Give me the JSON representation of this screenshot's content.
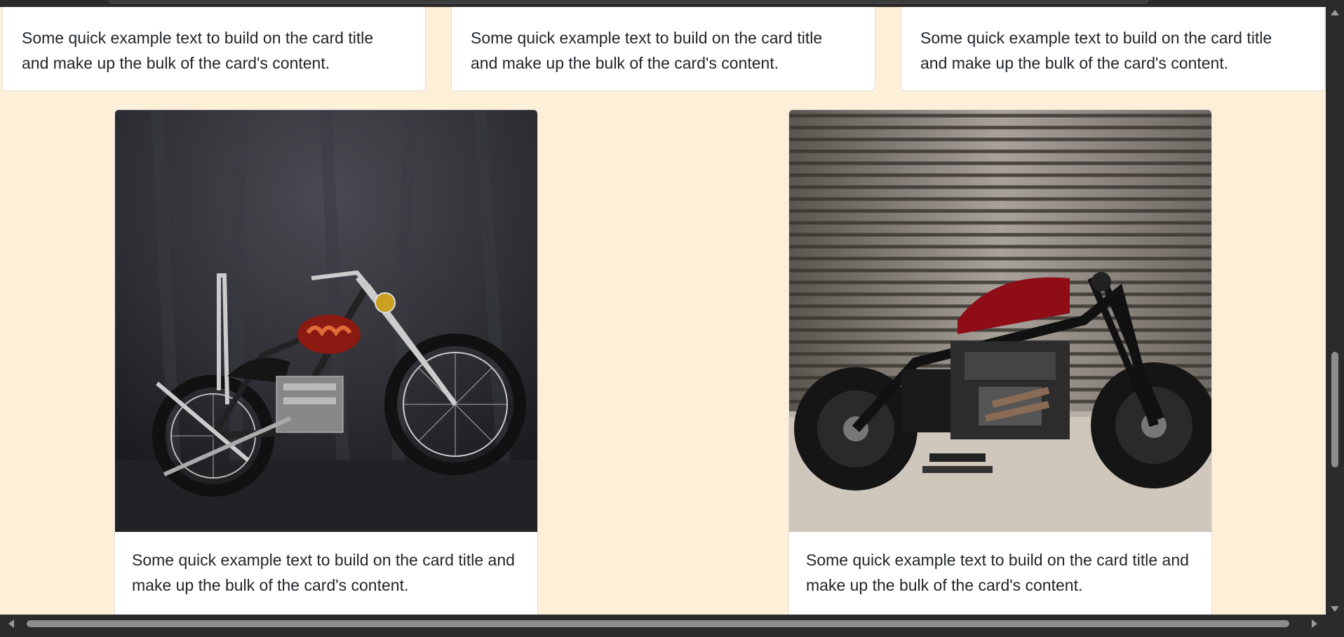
{
  "cards": {
    "top": [
      {
        "text": "Some quick example text to build on the card title and make up the bulk of the card's content."
      },
      {
        "text": "Some quick example text to build on the card title and make up the bulk of the card's content."
      },
      {
        "text": "Some quick example text to build on the card title and make up the bulk of the card's content."
      }
    ],
    "image_cards": [
      {
        "image": "chopper-motorcycle-photo",
        "text": "Some quick example text to build on the card title and make up the bulk of the card's content."
      },
      {
        "image": "bobber-motorcycle-photo",
        "text": "Some quick example text to build on the card title and make up the bulk of the card's content."
      }
    ]
  },
  "colors": {
    "page_background": "#feefd8",
    "card_background": "#ffffff",
    "text": "#212529",
    "scrollbar_track": "#2b2b2b",
    "scrollbar_thumb": "#8c8c8c"
  }
}
